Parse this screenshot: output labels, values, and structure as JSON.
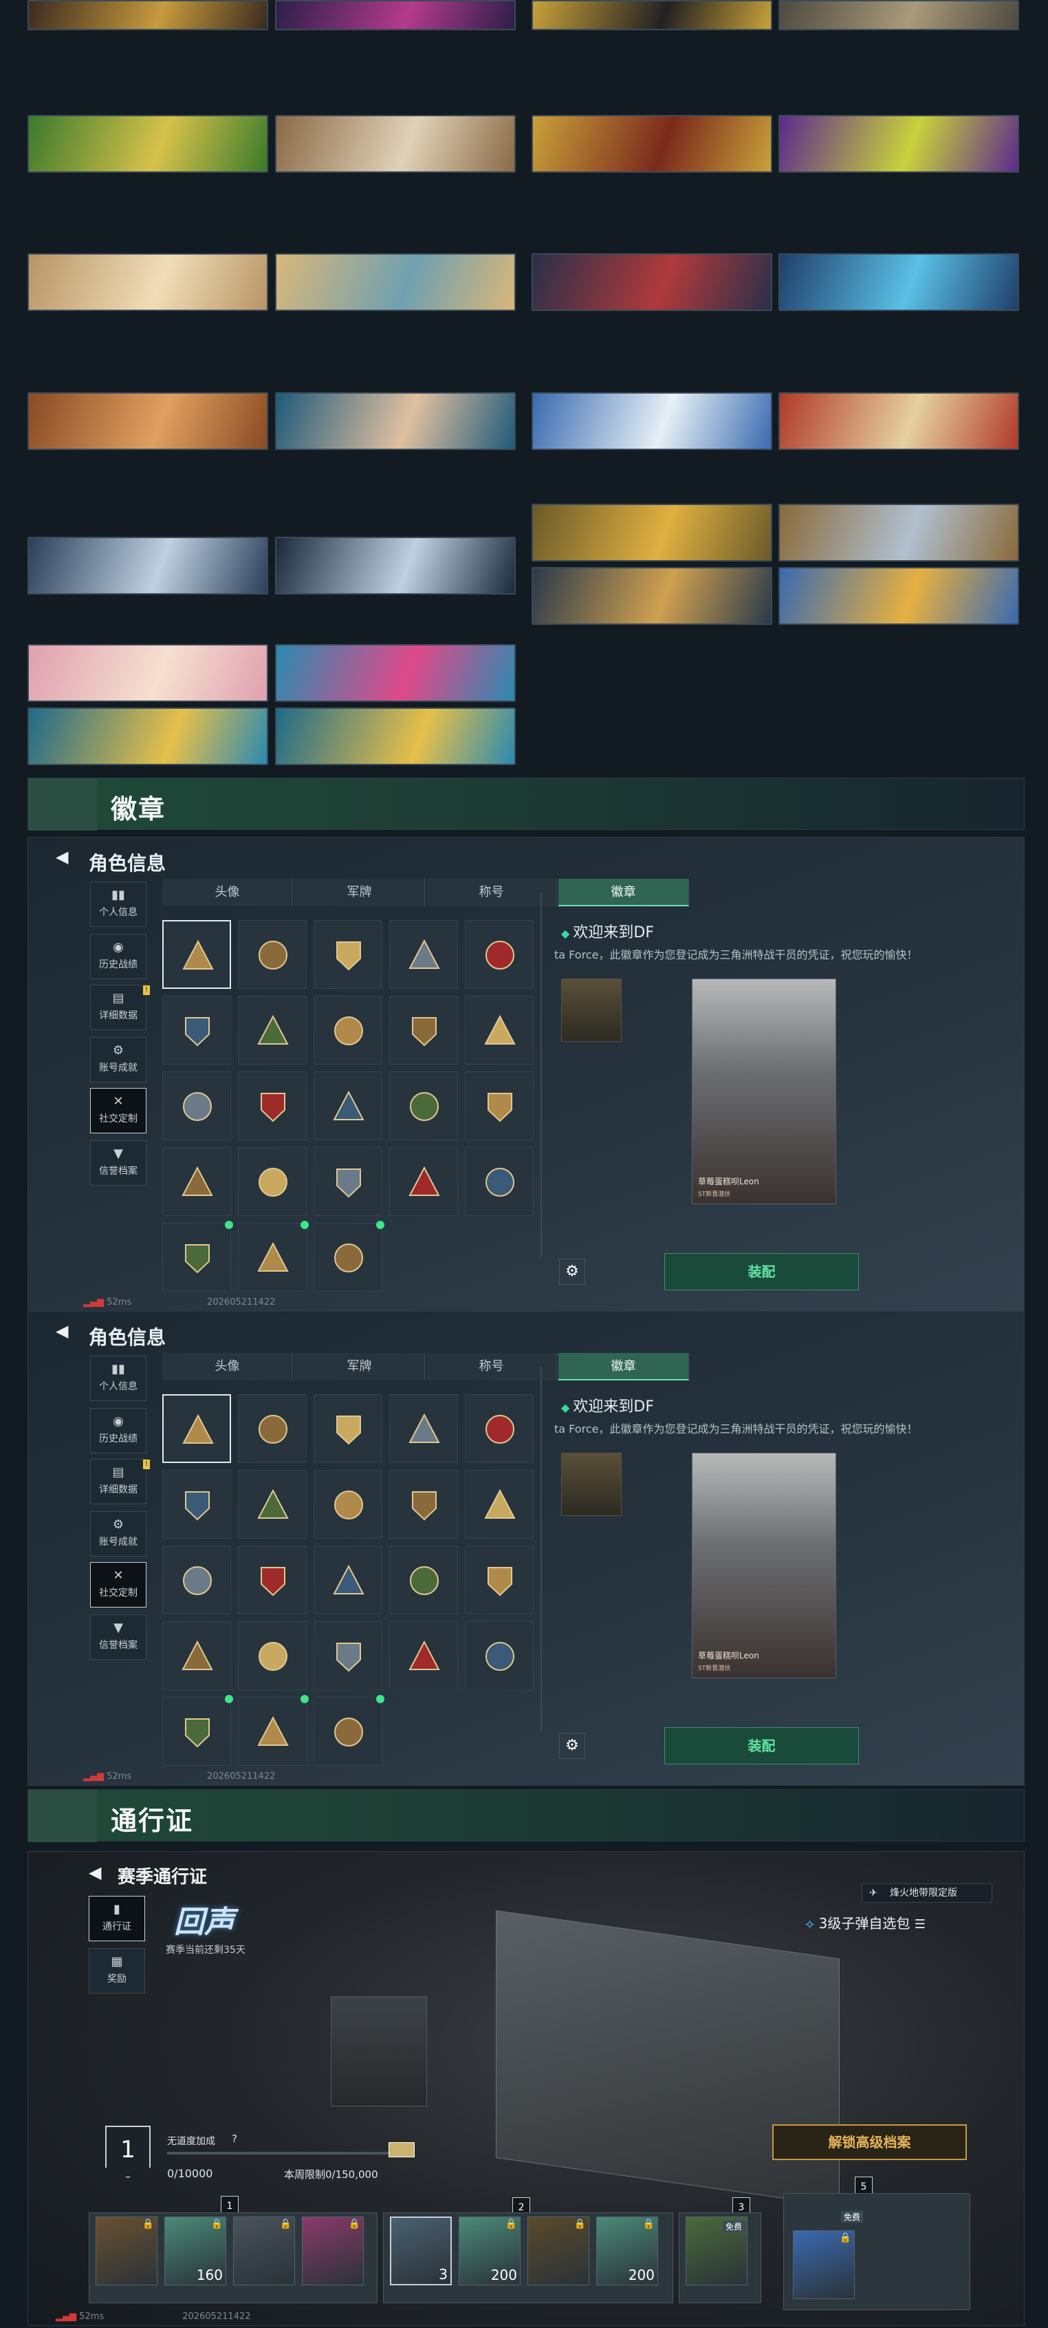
{
  "banners": [
    {
      "label": ""
    },
    {
      "label": ""
    },
    {
      "label": ""
    },
    {
      "label": ""
    },
    {
      "label": ""
    },
    {
      "label": ""
    },
    {
      "label": ""
    },
    {
      "label": ""
    },
    {
      "label": ""
    },
    {
      "label": ""
    },
    {
      "label": ""
    },
    {
      "label": ""
    },
    {
      "label": ""
    },
    {
      "label": ""
    },
    {
      "label": ""
    },
    {
      "label": ""
    },
    {
      "label": ""
    },
    {
      "label": ""
    },
    {
      "label": ""
    },
    {
      "label": ""
    },
    {
      "label": ""
    },
    {
      "label": ""
    },
    {
      "label": ""
    },
    {
      "label": ""
    }
  ],
  "sections": {
    "badges": "徽章",
    "pass": "通行证"
  },
  "profile": {
    "title": "角色信息",
    "nav": [
      {
        "icon": "▮▮",
        "label": "个人信息"
      },
      {
        "icon": "◉",
        "label": "历史战绩"
      },
      {
        "icon": "▤",
        "label": "详细数据"
      },
      {
        "icon": "⚙",
        "label": "账号成就"
      },
      {
        "icon": "✕",
        "label": "社交定制"
      },
      {
        "icon": "▼",
        "label": "信誉档案"
      }
    ],
    "tabs": [
      "头像",
      "军牌",
      "称号",
      "徽章"
    ],
    "detail_title": "欢迎来到DF",
    "detail_desc": "ta Force，此徽章作为您登记成为三角洲特战干员的凭证，祝您玩的愉快！",
    "card_name": "草莓蛋糕呗Leon",
    "card_sub": "ST新晋潜伏",
    "equip": "装配",
    "latency": "52ms",
    "build": "202605211422"
  },
  "season": {
    "title": "赛季通行证",
    "nav": [
      {
        "icon": "▮",
        "label": "通行证"
      },
      {
        "icon": "▦",
        "label": "奖励"
      }
    ],
    "logo": "回声",
    "ends": "赛季当前还剩35天",
    "limited": "烽火地带限定版",
    "pack": "3级子弹自选包",
    "unlock": "解锁高级档案",
    "level": "1",
    "bonus": "无道度加成",
    "help": "?",
    "xp": "0/10000",
    "weekly": "本周限制0/150,000",
    "free": "免费",
    "latency": "52ms",
    "build": "202605211422",
    "tiers": [
      "1",
      "2",
      "3",
      "5"
    ],
    "items": [
      {
        "qty": "",
        "lock": "🔒"
      },
      {
        "qty": "160",
        "lock": "🔒"
      },
      {
        "qty": "",
        "lock": "🔒"
      },
      {
        "qty": "",
        "lock": "🔒"
      },
      {
        "qty": "3",
        "lock": ""
      },
      {
        "qty": "200",
        "lock": "🔒"
      },
      {
        "qty": "",
        "lock": "🔒"
      },
      {
        "qty": "200",
        "lock": "🔒"
      },
      {
        "qty": "",
        "lock": ""
      },
      {
        "qty": "",
        "lock": "🔒"
      }
    ]
  },
  "colors": {
    "accent": "#3fd99a",
    "gold": "#d8a845",
    "bg": "#121a22"
  }
}
